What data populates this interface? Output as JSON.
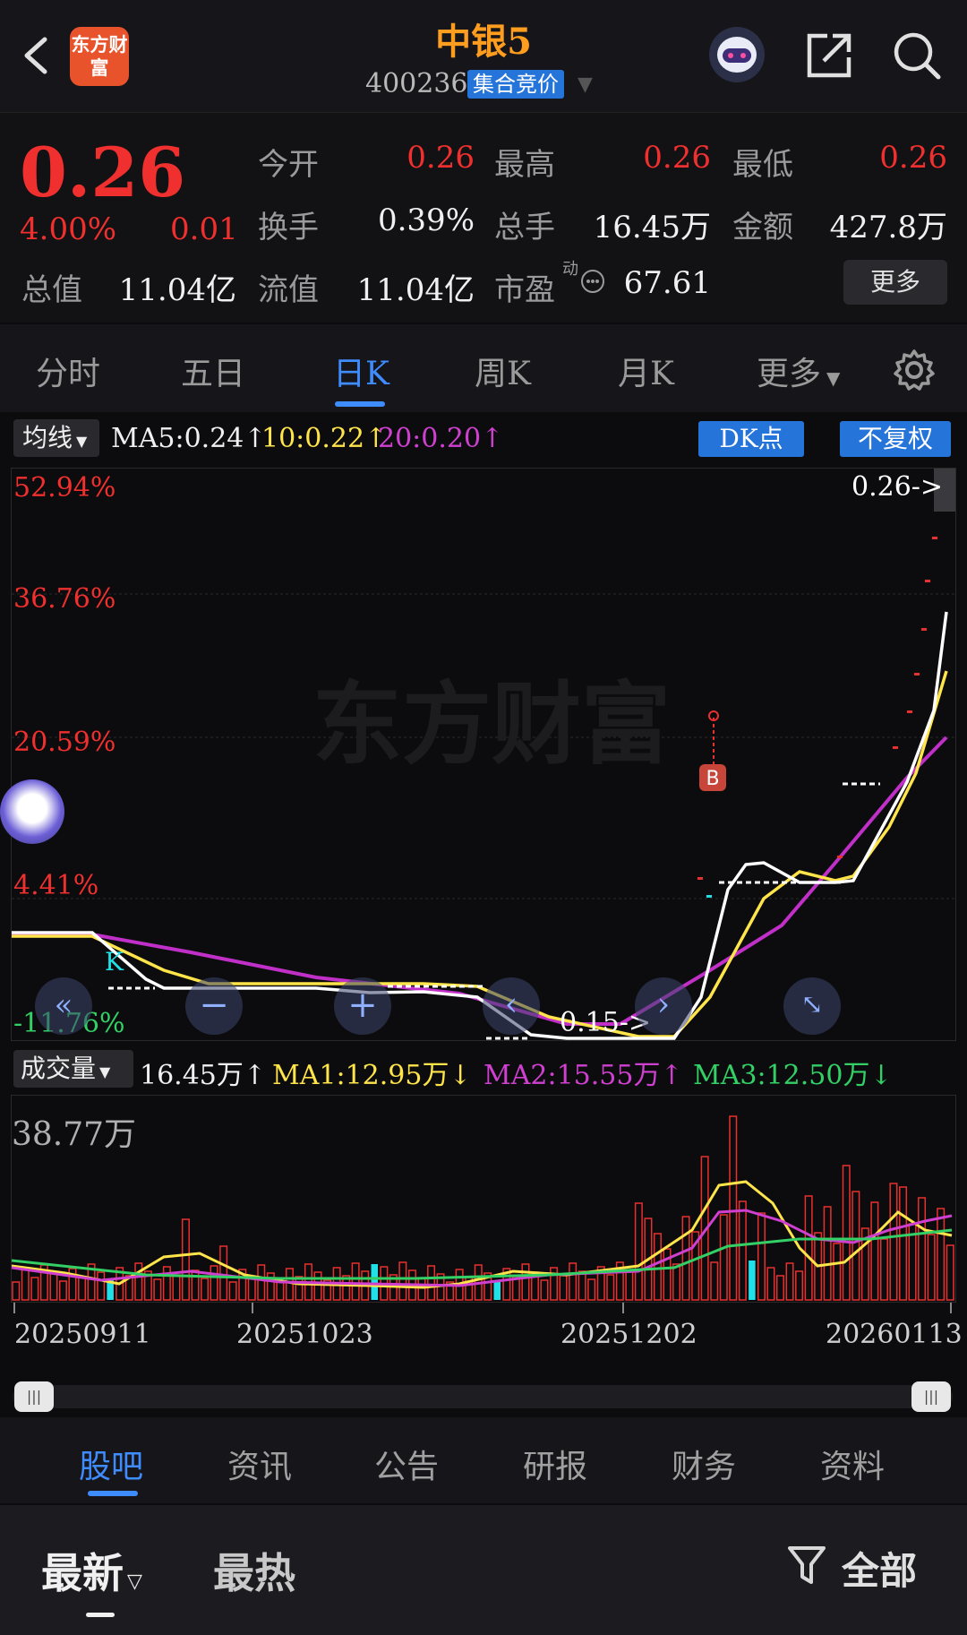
{
  "header": {
    "logo_text": "东方财富",
    "stock_name": "中银5",
    "stock_code": "400236",
    "auction_badge": "集合竞价"
  },
  "quote": {
    "price": "0.26",
    "change_pct": "4.00%",
    "change_amt": "0.01",
    "open_label": "今开",
    "open_value": "0.26",
    "high_label": "最高",
    "high_value": "0.26",
    "low_label": "最低",
    "low_value": "0.26",
    "turnover_label": "换手",
    "turnover_value": "0.39%",
    "volume_label": "总手",
    "volume_value": "16.45万",
    "amount_label": "金额",
    "amount_value": "427.8万",
    "mktcap_label": "总值",
    "mktcap_value": "11.04亿",
    "float_label": "流值",
    "float_value": "11.04亿",
    "pe_label": "市盈",
    "pe_sup": "动",
    "pe_value": "67.61",
    "more_label": "更多"
  },
  "tabs": [
    "分时",
    "五日",
    "日K",
    "周K",
    "月K",
    "更多"
  ],
  "active_tab": "日K",
  "kline": {
    "ma_select": "均线",
    "ma5": "MA5:0.24↑",
    "ma10": "10:0.22↑",
    "ma20": "20:0.20↑",
    "dk_button": "DK点",
    "adjust_button": "不复权",
    "pct_labels": [
      "52.94%",
      "36.76%",
      "20.59%",
      "4.41%",
      "-11.76%"
    ],
    "last_price_tag": "0.26->",
    "low_price_tag": "0.15->",
    "watermark": "东方财富",
    "b_marker": "B",
    "k_marker": "K",
    "colors": {
      "ma5": "#ffffff",
      "ma10": "#ffe44a",
      "ma20": "#c030c8",
      "up": "#e8302e",
      "down": "#20e0e8"
    }
  },
  "volume": {
    "select": "成交量",
    "current": "16.45万↑",
    "ma1": "MA1:12.95万↓",
    "ma2": "MA2:15.55万↑",
    "ma3": "MA3:12.50万↓",
    "max_label": "38.77万"
  },
  "dates": [
    "20250911",
    "20251023",
    "20251202",
    "20260113"
  ],
  "bottom_tabs": [
    "股吧",
    "资讯",
    "公告",
    "研报",
    "财务",
    "资料"
  ],
  "active_bottom_tab": "股吧",
  "sort": {
    "latest": "最新",
    "hot": "最热",
    "filter": "全部"
  }
}
